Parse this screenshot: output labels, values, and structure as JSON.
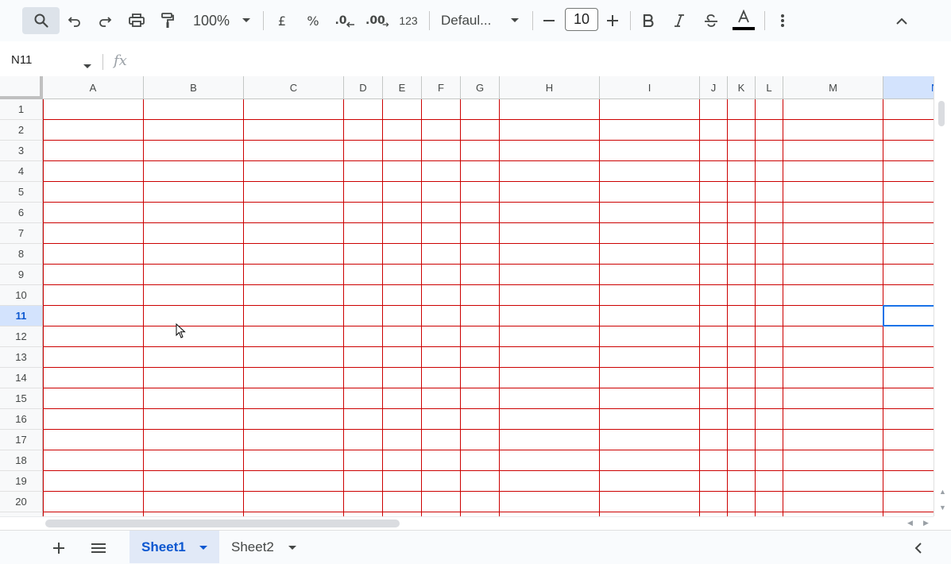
{
  "toolbar": {
    "zoom": "100%",
    "currency_symbol": "£",
    "percent_symbol": "%",
    "decrease_decimal": ".0",
    "increase_decimal": ".00",
    "more_formats": "123",
    "font_family": "Defaul...",
    "font_size": "10",
    "icons": [
      "search-icon",
      "undo-icon",
      "redo-icon",
      "print-icon",
      "paint-format-icon",
      "zoom-dropdown-icon",
      "font-dropdown-icon",
      "decrease-font-size-icon",
      "increase-font-size-icon",
      "bold-icon",
      "italic-icon",
      "strikethrough-icon",
      "text-color-icon",
      "more-options-icon",
      "collapse-toolbar-icon"
    ]
  },
  "formula_bar": {
    "name_box": "N11",
    "fx_label": "fx",
    "formula": ""
  },
  "grid": {
    "columns": [
      "A",
      "B",
      "C",
      "D",
      "E",
      "F",
      "G",
      "H",
      "I",
      "J",
      "K",
      "L",
      "M",
      "N"
    ],
    "rows": [
      "1",
      "2",
      "3",
      "4",
      "5",
      "6",
      "7",
      "8",
      "9",
      "10",
      "11",
      "12",
      "13",
      "14",
      "15",
      "16",
      "17",
      "18",
      "19",
      "20"
    ],
    "selected_cell": "N11",
    "selected_row": "11",
    "selected_column": "N",
    "border_color": "#cc0000",
    "selection_color": "#1a73e8"
  },
  "sheets": {
    "tabs": [
      {
        "label": "Sheet1",
        "active": true
      },
      {
        "label": "Sheet2",
        "active": false
      }
    ]
  },
  "colors": {
    "accent": "#0b57d0",
    "header_selected_bg": "#d3e3fd",
    "toolbar_bg": "#f9fbfd"
  }
}
